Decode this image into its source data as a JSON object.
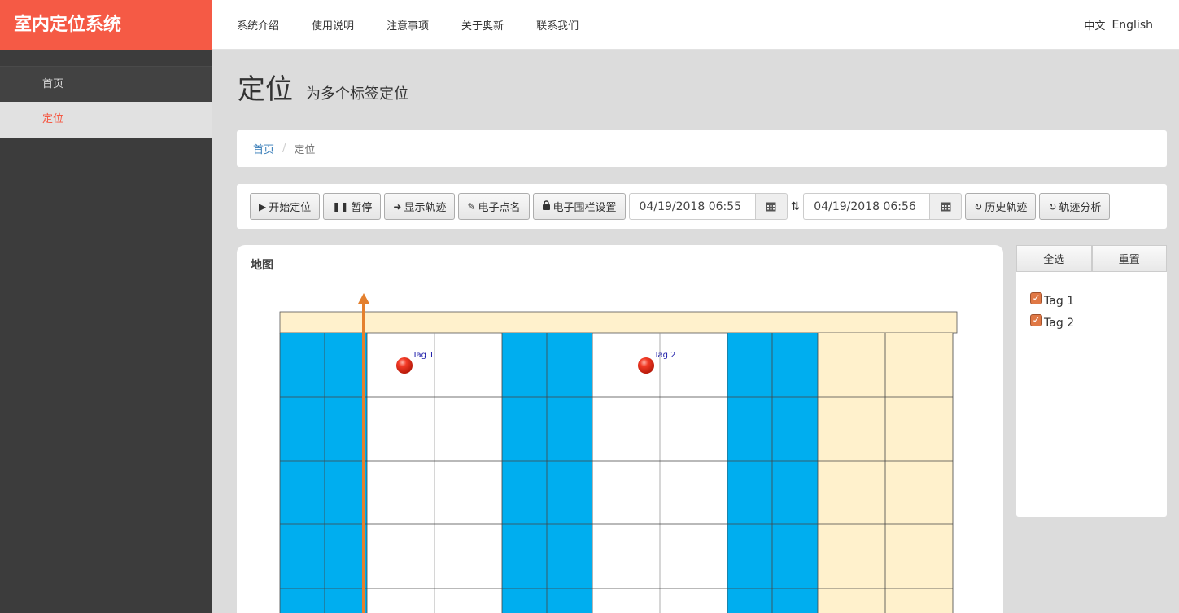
{
  "brand": {
    "title": "室内定位系统"
  },
  "topnav": {
    "items": [
      "系统介绍",
      "使用说明",
      "注意事项",
      "关于奥新",
      "联系我们"
    ]
  },
  "lang": {
    "zh": "中文",
    "en": "English"
  },
  "sidebar": {
    "items": [
      {
        "label": "首页"
      },
      {
        "label": "定位"
      }
    ]
  },
  "page": {
    "title": "定位",
    "subtitle": "为多个标签定位"
  },
  "breadcrumb": {
    "home": "首页",
    "current": "定位",
    "separator": "/"
  },
  "toolbar": {
    "start": "开始定位",
    "pause": "暂停",
    "show_track": "显示轨迹",
    "rollcall": "电子点名",
    "fence": "电子围栏设置",
    "date_from": "04/19/2018 06:55",
    "date_to": "04/19/2018 06:56",
    "history": "历史轨迹",
    "analysis": "轨迹分析"
  },
  "icons": {
    "start": "play-icon",
    "pause": "pause-icon",
    "show_track": "arrow-circle-icon",
    "rollcall": "pencil-icon",
    "fence": "lock-icon",
    "calendar": "calendar-icon",
    "swap": "sort-icon",
    "history": "refresh-icon",
    "analysis": "refresh-icon"
  },
  "map": {
    "title": "地图",
    "tags": [
      {
        "label": "Tag 1"
      },
      {
        "label": "Tag 2"
      }
    ],
    "colors": {
      "blue": "#00aeef",
      "cream": "#fff1cc",
      "arrow": "#e4802e",
      "tag": "#e8281b"
    }
  },
  "tag_panel": {
    "select_all": "全选",
    "reset": "重置",
    "tags": [
      {
        "label": "Tag 1",
        "checked": true
      },
      {
        "label": "Tag 2",
        "checked": true
      }
    ]
  },
  "colors": {
    "brand": "#f55a45",
    "sidebar": "#3c3c3c",
    "active_text": "#f55a45",
    "link": "#337ab7"
  }
}
